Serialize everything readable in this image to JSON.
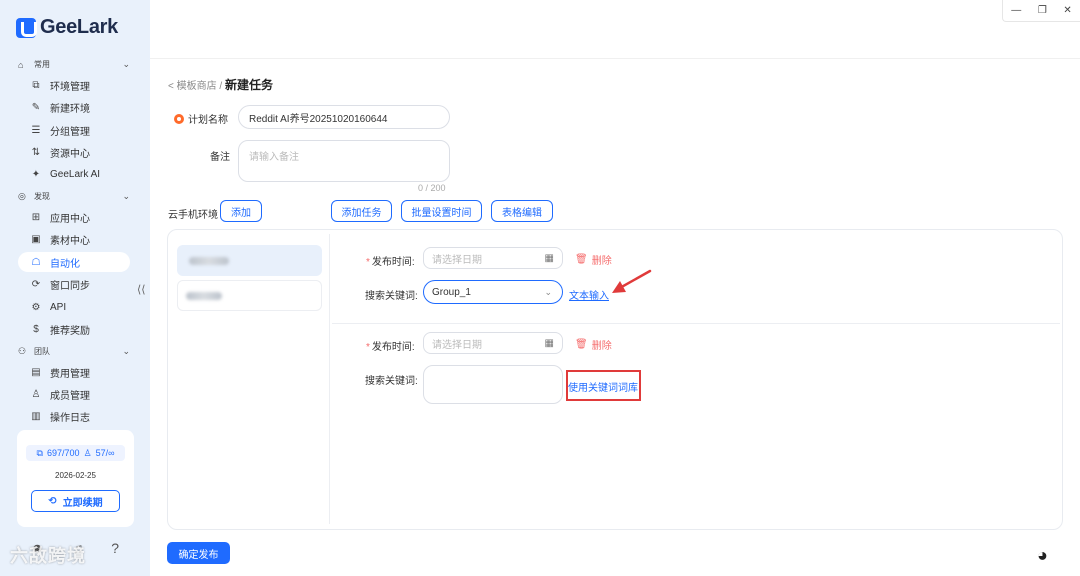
{
  "app": {
    "name": "GeeLark"
  },
  "sidebar": {
    "sections": [
      {
        "label": "常用",
        "icon": "home-icon"
      },
      {
        "label": "发现",
        "icon": "eye-icon"
      },
      {
        "label": "团队",
        "icon": "team-icon"
      }
    ],
    "items": [
      {
        "label": "环境管理",
        "icon": "env-icon"
      },
      {
        "label": "新建环境",
        "icon": "edit-icon"
      },
      {
        "label": "分组管理",
        "icon": "list-icon"
      },
      {
        "label": "资源中心",
        "icon": "resource-icon"
      },
      {
        "label": "GeeLark AI",
        "icon": "ai-icon"
      },
      {
        "label": "应用中心",
        "icon": "apps-icon"
      },
      {
        "label": "素材中心",
        "icon": "material-icon"
      },
      {
        "label": "自动化",
        "icon": "robot-icon"
      },
      {
        "label": "窗口同步",
        "icon": "sync-icon"
      },
      {
        "label": "API",
        "icon": "api-icon"
      },
      {
        "label": "推荐奖励",
        "icon": "dollar-icon"
      },
      {
        "label": "费用管理",
        "icon": "billing-icon"
      },
      {
        "label": "成员管理",
        "icon": "member-icon"
      },
      {
        "label": "操作日志",
        "icon": "log-icon"
      }
    ],
    "active_item": "自动化",
    "quota": {
      "envs": "697/700",
      "members": "57/∞",
      "date": "2026-02-25",
      "renew_label": "立即续期"
    },
    "watermark": "六敌跨境"
  },
  "window_controls": {
    "minimize": "—",
    "restore": "❐",
    "close": "✕"
  },
  "breadcrumb": {
    "parent": "< 模板商店",
    "sep": " / ",
    "current": "新建任务"
  },
  "form": {
    "plan_name_label": "计划名称",
    "plan_name_value": "Reddit AI养号20251020160644",
    "remark_label": "备注",
    "remark_placeholder": "请输入备注",
    "remark_counter": "0 / 200",
    "cloud_env_label": "云手机环境",
    "add_label": "添加",
    "add_task_label": "添加任务",
    "batch_time_label": "批量设置时间",
    "table_edit_label": "表格编辑"
  },
  "tasks": [
    {
      "publish_time_label": "发布时间:",
      "date_placeholder": "请选择日期",
      "delete_label": "删除",
      "keyword_label": "搜索关键词:",
      "keyword_value": "Group_1",
      "link_label": "文本输入"
    },
    {
      "publish_time_label": "发布时间:",
      "date_placeholder": "请选择日期",
      "delete_label": "删除",
      "keyword_label": "搜索关键词:",
      "link_label": "使用关键词词库"
    }
  ],
  "submit_label": "确定发布",
  "colors": {
    "accent": "#1f6bff",
    "danger": "#f56c6c",
    "annotation": "#e03a3a",
    "sidebar_bg": "#e9f1fb"
  }
}
